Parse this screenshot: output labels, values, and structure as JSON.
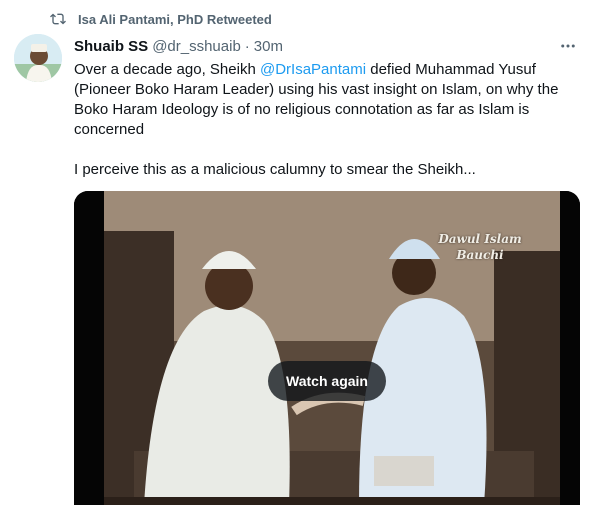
{
  "retweet": {
    "icon": "retweet-icon",
    "text": "Isa Ali Pantami, PhD Retweeted"
  },
  "tweet": {
    "author_name": "Shuaib SS",
    "handle": "@dr_sshuaib",
    "separator": "·",
    "time": "30m",
    "more_icon": "more-options-icon",
    "body": {
      "line1_before": "Over a decade ago, Sheikh ",
      "mention": "@DrIsaPantami",
      "line1_after": " defied Muhammad Yusuf (Pioneer Boko Haram Leader)  using his vast insight on Islam, on why the Boko Haram Ideology is of no religious connotation as far as Islam is concerned",
      "paragraph2": "I perceive this as a malicious calumny to smear the Sheikh..."
    },
    "media": {
      "watch_again_label": "Watch again",
      "caption_line1": "Dawul Islam",
      "caption_line2": "Bauchi"
    }
  },
  "colors": {
    "accent": "#1d9bf0",
    "secondary_text": "#536471",
    "primary_text": "#0f1419"
  }
}
